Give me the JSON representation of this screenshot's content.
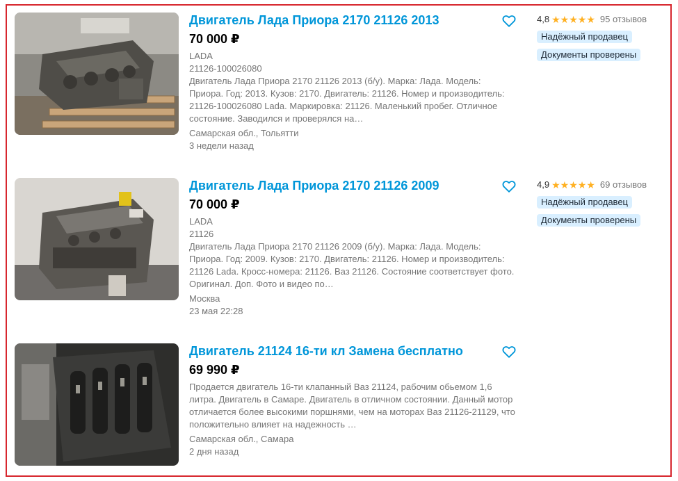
{
  "colors": {
    "title": "#0096d9",
    "frame": "#d7262e",
    "star": "#ffb021",
    "badge_bg": "#d9efff"
  },
  "listings": [
    {
      "title": "Двигатель Лада Приора 2170 21126 2013",
      "price": "70 000 ₽",
      "brand": "LADA",
      "part_number": "21126-100026080",
      "description": "Двигатель Лада Приора 2170 21126 2013 (б/у). Марка: Лада. Модель: Приора. Год: 2013. Кузов: 2170. Двигатель: 21126. Номер и производитель: 21126-100026080 Lada. Маркировка: 21126. Маленький пробег. Отличное состояние. Заводился и проверялся на…",
      "location": "Самарская обл., Тольятти",
      "time": "3 недели назад",
      "rating": "4,8",
      "reviews": "95 отзывов",
      "badges": [
        "Надёжный продавец",
        "Документы проверены"
      ],
      "favorite_icon": "heart-outline-icon"
    },
    {
      "title": "Двигатель Лада Приора 2170 21126 2009",
      "price": "70 000 ₽",
      "brand": "LADA",
      "part_number": "21126",
      "description": "Двигатель Лада Приора 2170 21126 2009 (б/у). Марка: Лада. Модель: Приора. Год: 2009. Кузов: 2170. Двигатель: 21126. Номер и производитель: 21126 Lada. Кросс-номера: 21126. Ваз 21126. Состояние соответствует фото. Оригинал. Доп. Фото и видео по…",
      "location": "Москва",
      "time": "23 мая 22:28",
      "rating": "4,9",
      "reviews": "69 отзывов",
      "badges": [
        "Надёжный продавец",
        "Документы проверены"
      ],
      "favorite_icon": "heart-outline-icon"
    },
    {
      "title": "Двигатель 21124 16-ти кл Замена бесплатно",
      "price": "69 990 ₽",
      "description": "Продается двигатель 16-ти клапанный Ваз 21124, рабочим обьемом 1,6 литра. Двигатель в Самаре. Двигатель в отличном состоянии. Данный мотор отличается более высокими поршнями, чем на моторах Ваз 21126-21129, что положительно влияет на надежность …",
      "location": "Самарская обл., Самара",
      "time": "2 дня назад",
      "favorite_icon": "heart-outline-icon"
    }
  ]
}
